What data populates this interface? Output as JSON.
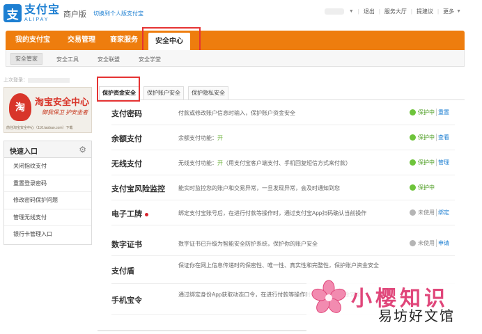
{
  "header": {
    "logo_mark": "支",
    "logo_cn": "支付宝",
    "logo_en": "ALIPAY",
    "edition": "商户版",
    "switch_link": "切换到个人版支付宝",
    "topnav": {
      "items": [
        "退出",
        "服务大厅",
        "提建议",
        "更多"
      ]
    }
  },
  "mainnav": {
    "items": [
      "我的支付宝",
      "交易管理",
      "商家服务",
      "安全中心"
    ],
    "active": "安全中心"
  },
  "subnav": {
    "items": [
      "安全管家",
      "安全工具",
      "安全联盟",
      "安全学堂"
    ],
    "active": "安全管家"
  },
  "sidebar": {
    "last_login_label": "上次登录：",
    "banner": {
      "seal_char": "淘",
      "title": "淘宝安全中心",
      "slogan": "御我保卫  护安坐者",
      "footer": "前往淘宝安全中心（110.taobao.com）下载"
    },
    "quick": {
      "title": "快速入口",
      "items": [
        "关闭指纹支付",
        "重置登录密码",
        "修改密码保护问题",
        "管理无线支付",
        "银行卡管理入口"
      ]
    }
  },
  "tabs": {
    "items": [
      "保护资金安全",
      "保护账户安全",
      "保护隐私安全"
    ],
    "active": "保护资金安全"
  },
  "security_rows": [
    {
      "name": "支付密码",
      "desc": "付款或修改账户信息时输入，保护账户资金安全",
      "status": "保护中",
      "action": "重置",
      "on": true
    },
    {
      "name": "余额支付",
      "desc_pre": "余额支付功能：",
      "desc_ok": "开",
      "desc_post": "",
      "status": "保护中",
      "action": "查看",
      "on": true
    },
    {
      "name": "无线支付",
      "desc_pre": "无线支付功能：",
      "desc_ok": "开",
      "desc_post": "（用支付宝客户端支付、手机回复短信方式来付款）",
      "status": "保护中",
      "action": "管理",
      "on": true
    },
    {
      "name": "支付宝风险监控",
      "desc": "能实时监控您的账户和交易异常，一旦发现异常，会及时通知到您",
      "status": "保护中",
      "action": "",
      "on": true
    },
    {
      "name": "电子工牌",
      "desc": "绑定支付宝账号后，在进行付款等操作时，通过支付宝App扫码确认当前操作",
      "status": "未使用",
      "action": "绑定",
      "on": false
    },
    {
      "name": "数字证书",
      "desc": "数字证书已升级为智能安全防护系统，保护你的账户安全",
      "status": "未使用",
      "action": "申请",
      "on": false
    },
    {
      "name": "支付盾",
      "desc": "保证你在网上信息传递时的保密性、唯一性、真实性和完整性，保护账户资金安全",
      "status": "",
      "action": "",
      "on": false
    },
    {
      "name": "手机宝令",
      "desc": "通过绑定身份App获取动态口令，在进行付款等操作时，保护账户资金安全。",
      "status": "",
      "action": "",
      "on": false
    }
  ],
  "watermark": {
    "big": "小樱知识",
    "small": "易坊好文馆"
  },
  "colors": {
    "brand_orange": "#ee7d0e",
    "alipay_blue": "#1d7fd2",
    "status_green": "#6ec43b",
    "highlight_red": "#e53333"
  }
}
